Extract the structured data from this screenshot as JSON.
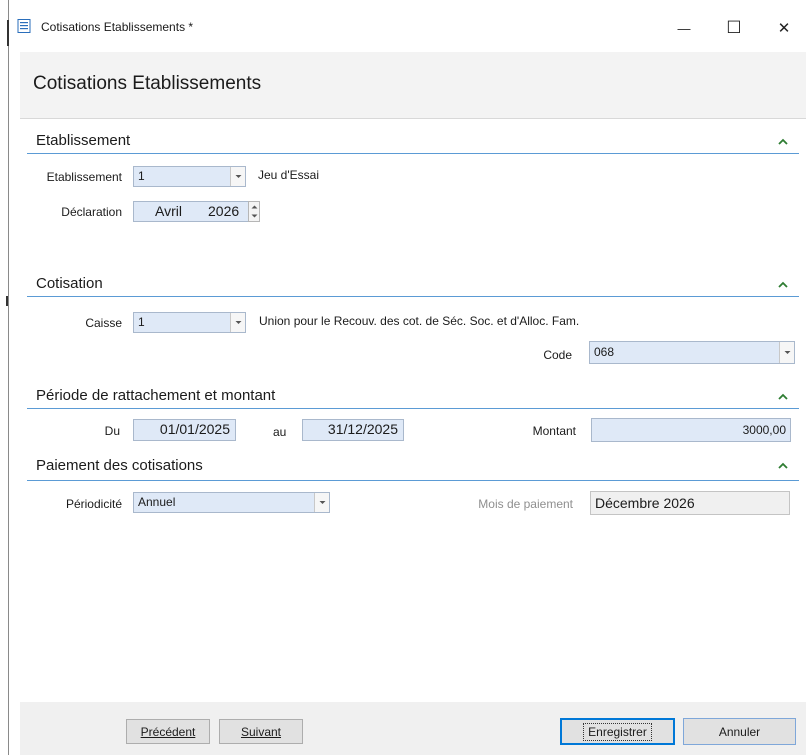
{
  "window": {
    "title": "Cotisations Etablissements *",
    "minimize": "—",
    "maximize": "☐",
    "close": "✕"
  },
  "page": {
    "title": "Cotisations Etablissements"
  },
  "colors": {
    "accent": "#5b9bd5",
    "field_bg": "#dfe9f7",
    "chevron": "#2e7d32"
  },
  "sections": {
    "etablissement": {
      "title": "Etablissement",
      "etab_label": "Etablissement",
      "etab_value": "1",
      "etab_desc": "Jeu d'Essai",
      "decl_label": "Déclaration",
      "decl_month": "Avril",
      "decl_year": "2026"
    },
    "cotisation": {
      "title": "Cotisation",
      "caisse_label": "Caisse",
      "caisse_value": "1",
      "caisse_desc": "Union pour le Recouv. des cot. de Séc. Soc. et d'Alloc. Fam.",
      "code_label": "Code",
      "code_value": "068"
    },
    "periode": {
      "title": "Période de rattachement et montant",
      "du_label": "Du",
      "du_value": "01/01/2025",
      "au_label": "au",
      "au_value": "31/12/2025",
      "montant_label": "Montant",
      "montant_value": "3000,00"
    },
    "paiement": {
      "title": "Paiement des cotisations",
      "periodicite_label": "Périodicité",
      "periodicite_value": "Annuel",
      "mois_label": "Mois de paiement",
      "mois_value": "Décembre 2026"
    }
  },
  "buttons": {
    "precedent": "Précédent",
    "suivant": "Suivant",
    "enregistrer": "Enregistrer",
    "annuler": "Annuler"
  }
}
